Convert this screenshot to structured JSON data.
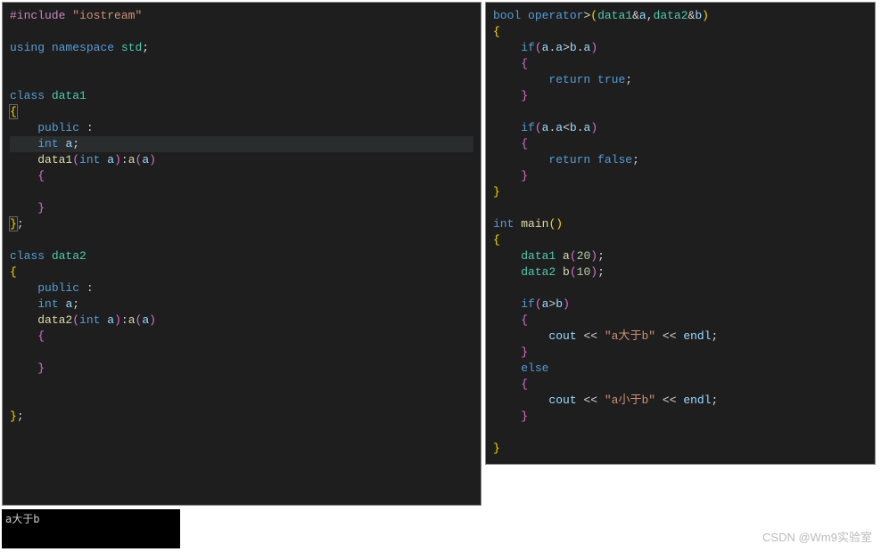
{
  "left": {
    "include_kw": "#include",
    "include_arg": "\"iostream\"",
    "using": "using",
    "namespace": "namespace",
    "std": "std",
    "class_kw": "class",
    "data1": "data1",
    "data2": "data2",
    "public": "public",
    "int": "int",
    "a": "a",
    "ctor1": "data1",
    "ctor2": "data2"
  },
  "right": {
    "bool": "bool",
    "operator_kw": "operator",
    "gt": ">",
    "data1": "data1",
    "data2": "data2",
    "amp": "&",
    "a": "a",
    "b": "b",
    "if_kw": "if",
    "else_kw": "else",
    "return_kw": "return",
    "true_kw": "true",
    "false_kw": "false",
    "int": "int",
    "main": "main",
    "aval": "20",
    "bval": "10",
    "cout": "cout",
    "str_gt": "\"a大于b\"",
    "str_lt": "\"a小于b\"",
    "endl": "endl"
  },
  "console": {
    "output": "a大于b"
  },
  "watermark": "CSDN @Wm9实验室"
}
